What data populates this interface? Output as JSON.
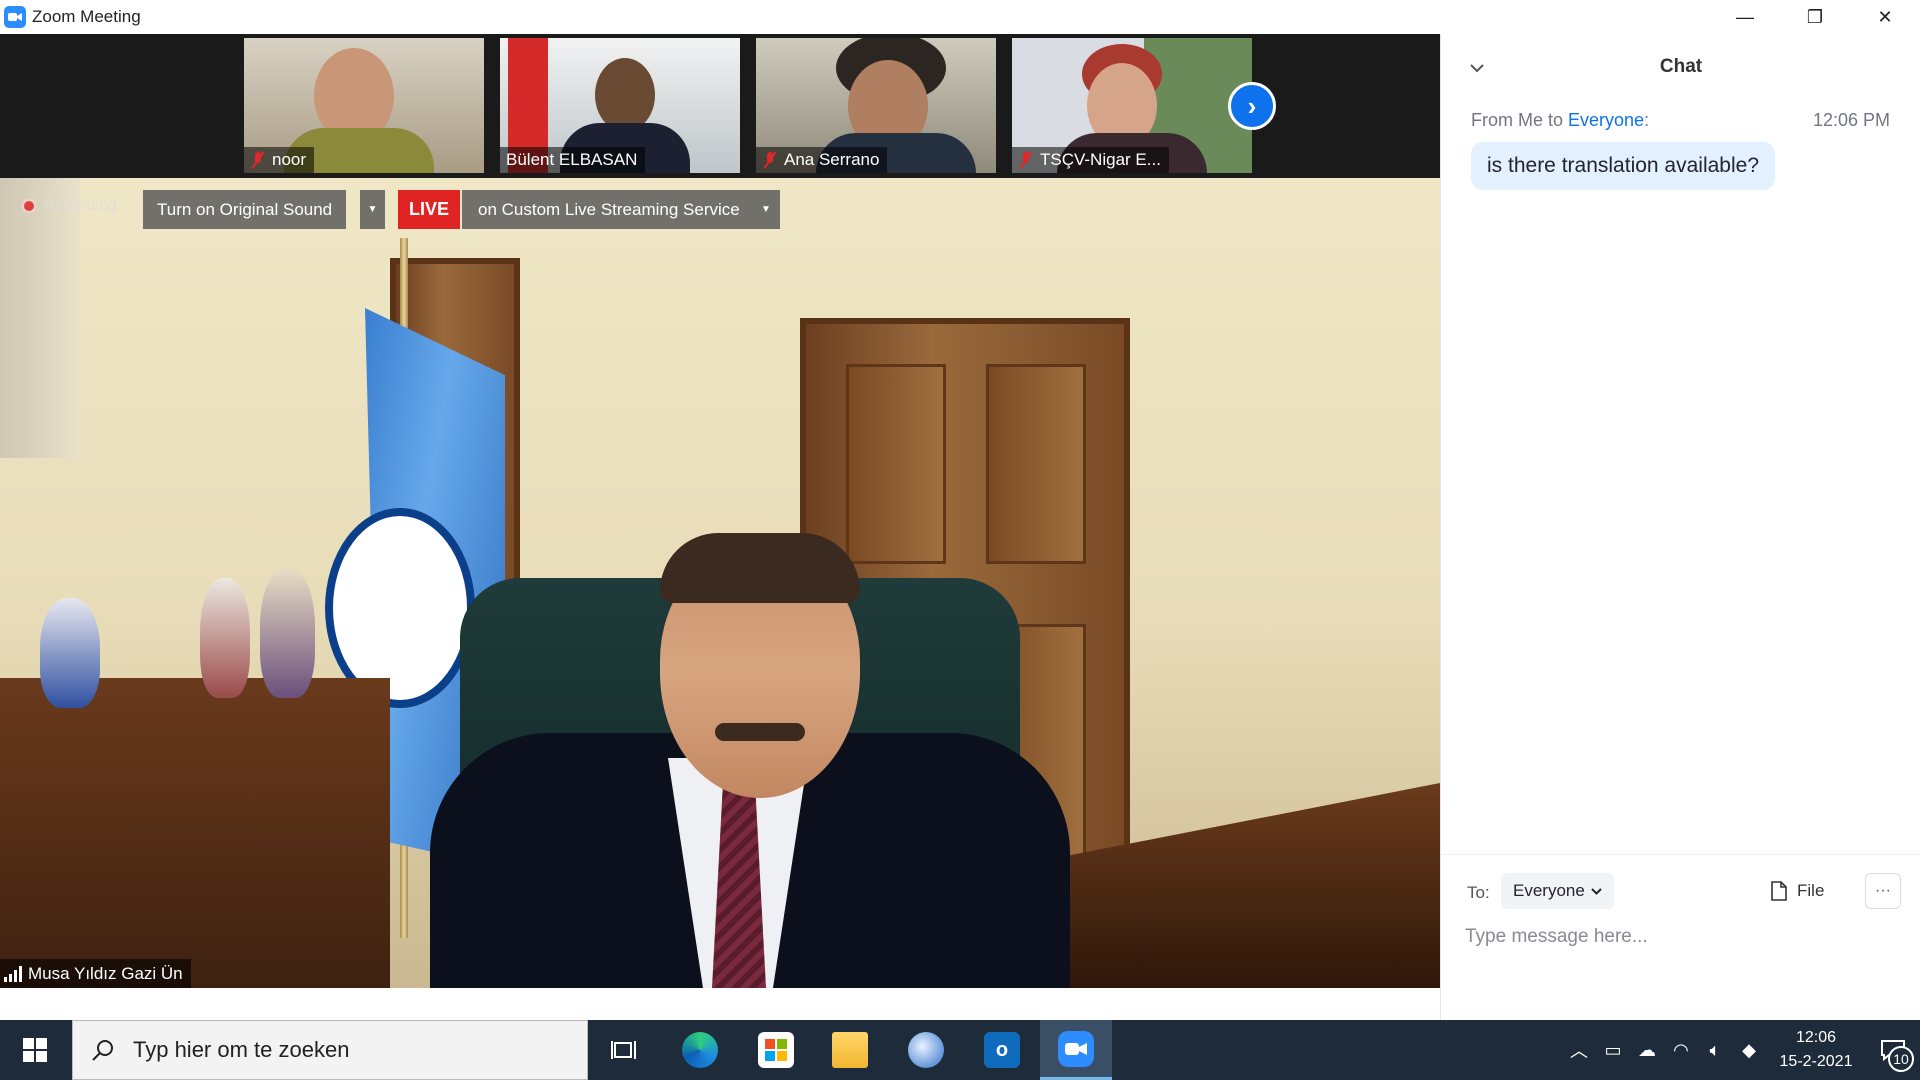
{
  "window": {
    "title": "Zoom Meeting",
    "controls": {
      "minimize": "—",
      "restore": "❐",
      "close": "✕"
    }
  },
  "gallery": {
    "tiles": [
      {
        "name": "noor",
        "muted": true
      },
      {
        "name": "Bülent ELBASAN",
        "muted": false
      },
      {
        "name": "Ana Serrano",
        "muted": true
      },
      {
        "name": "TSÇV-Nigar E...",
        "muted": true
      }
    ],
    "next_icon": "chevron-right-icon"
  },
  "main_video": {
    "recording_label": "Recording",
    "original_sound_button": "Turn on Original Sound",
    "live_badge": "LIVE",
    "live_service": "on Custom Live Streaming Service",
    "speaker_name": "Musa Yıldız Gazi Ün"
  },
  "chat": {
    "title": "Chat",
    "messages": [
      {
        "from": "From Me to ",
        "to": "Everyone",
        "suffix": ":",
        "time": "12:06 PM",
        "text": "is there translation available?"
      }
    ],
    "footer": {
      "to_label": "To:",
      "recipient": "Everyone",
      "file_label": "File",
      "more_label": "···",
      "placeholder": "Type message here..."
    }
  },
  "taskbar": {
    "search_placeholder": "Typ hier om te zoeken",
    "apps": [
      "task-view",
      "edge",
      "store",
      "file-explorer",
      "thunderbird",
      "outlook",
      "zoom"
    ],
    "clock_time": "12:06",
    "clock_date": "15-2-2021",
    "notification_count": "10"
  },
  "colors": {
    "zoom_blue": "#0e72ed",
    "live_red": "#e02424",
    "muted_red": "#e02828",
    "chat_bubble": "#e3f0ff",
    "taskbar": "#1e2b3a"
  }
}
